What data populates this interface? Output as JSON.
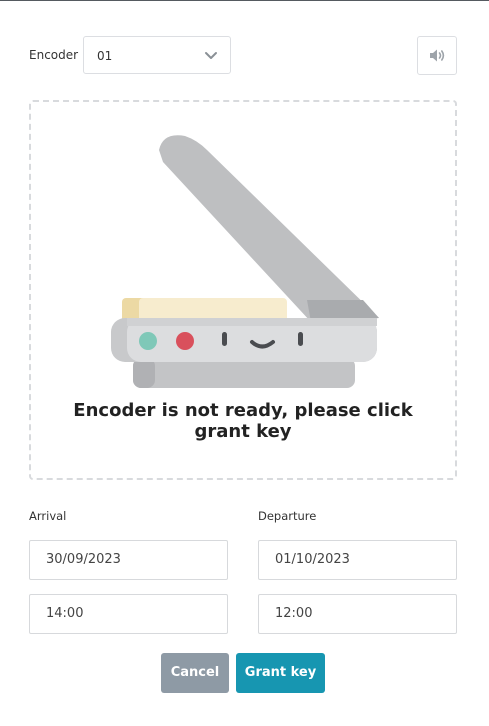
{
  "encoder": {
    "label": "Encoder",
    "selected": "01",
    "chevron_icon": "chevron-down-icon",
    "sound_icon": "speaker-icon"
  },
  "status": {
    "message": "Encoder is not ready, please click grant key",
    "illustration_icon": "scanner-icon"
  },
  "arrival": {
    "label": "Arrival",
    "date": "30/09/2023",
    "time": "14:00"
  },
  "departure": {
    "label": "Departure",
    "date": "01/10/2023",
    "time": "12:00"
  },
  "actions": {
    "cancel_label": "Cancel",
    "grant_label": "Grant key"
  },
  "colors": {
    "accent": "#1796b1",
    "cancel": "#8e9aa5",
    "border": "#dcdee2"
  }
}
